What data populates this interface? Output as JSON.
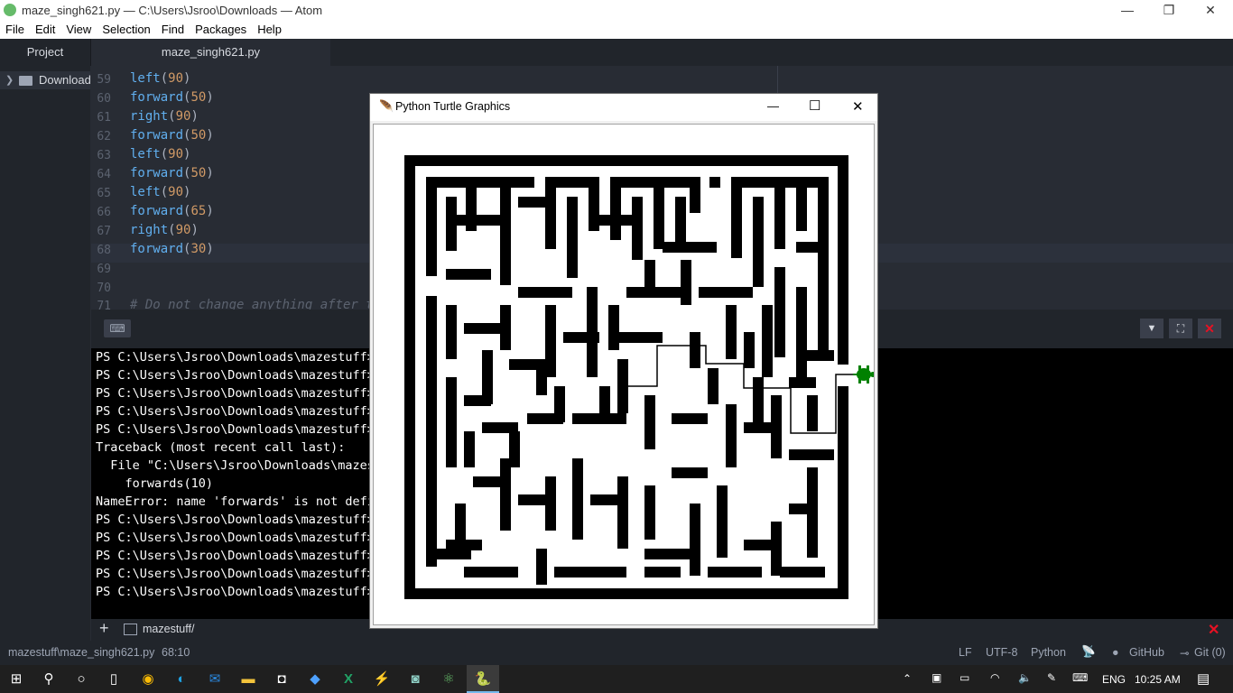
{
  "window": {
    "title": "maze_singh621.py — C:\\Users\\Jsroo\\Downloads — Atom",
    "minimize": "—",
    "restore": "❐",
    "close": "✕"
  },
  "menu": [
    "File",
    "Edit",
    "View",
    "Selection",
    "Find",
    "Packages",
    "Help"
  ],
  "tabs": {
    "project": "Project",
    "file": "maze_singh621.py"
  },
  "tree": {
    "folder": "Downloads"
  },
  "editor": {
    "lines": [
      {
        "n": "59",
        "fn": "left",
        "arg": "90"
      },
      {
        "n": "60",
        "fn": "forward",
        "arg": "50"
      },
      {
        "n": "61",
        "fn": "right",
        "arg": "90"
      },
      {
        "n": "62",
        "fn": "forward",
        "arg": "50"
      },
      {
        "n": "63",
        "fn": "left",
        "arg": "90"
      },
      {
        "n": "64",
        "fn": "forward",
        "arg": "50"
      },
      {
        "n": "65",
        "fn": "left",
        "arg": "90"
      },
      {
        "n": "66",
        "fn": "forward",
        "arg": "65"
      },
      {
        "n": "67",
        "fn": "right",
        "arg": "90"
      },
      {
        "n": "68",
        "fn": "forward",
        "arg": "30"
      },
      {
        "n": "69",
        "fn": "",
        "arg": ""
      },
      {
        "n": "70",
        "fn": "",
        "arg": ""
      }
    ],
    "comment": "# Do not change anything after thi"
  },
  "terminal": {
    "lines": [
      "PS C:\\Users\\Jsroo\\Downloads\\mazestuff>",
      "PS C:\\Users\\Jsroo\\Downloads\\mazestuff>",
      "PS C:\\Users\\Jsroo\\Downloads\\mazestuff>",
      "PS C:\\Users\\Jsroo\\Downloads\\mazestuff>",
      "PS C:\\Users\\Jsroo\\Downloads\\mazestuff>",
      "Traceback (most recent call last):",
      "  File \"C:\\Users\\Jsroo\\Downloads\\mazestu",
      "    forwards(10)",
      "NameError: name 'forwards' is not define",
      "PS C:\\Users\\Jsroo\\Downloads\\mazestuff>",
      "PS C:\\Users\\Jsroo\\Downloads\\mazestuff>",
      "PS C:\\Users\\Jsroo\\Downloads\\mazestuff>",
      "PS C:\\Users\\Jsroo\\Downloads\\mazestuff>",
      "PS C:\\Users\\Jsroo\\Downloads\\mazestuff>"
    ],
    "tab_label": "mazestuff/",
    "add": "+"
  },
  "status": {
    "path": "mazestuff\\maze_singh621.py",
    "position": "68:10",
    "eol": "LF",
    "encoding": "UTF-8",
    "grammar": "Python",
    "github": "GitHub",
    "git": "Git (0)"
  },
  "turtle": {
    "title": "Python Turtle Graphics",
    "minimize": "—",
    "maximize": "☐",
    "close": "✕"
  },
  "taskbar": {
    "lang": "ENG",
    "time": "10:25 AM"
  },
  "colors": {
    "turtle": "#008000",
    "maze_wall": "#000000",
    "accent_close": "#e81123"
  }
}
